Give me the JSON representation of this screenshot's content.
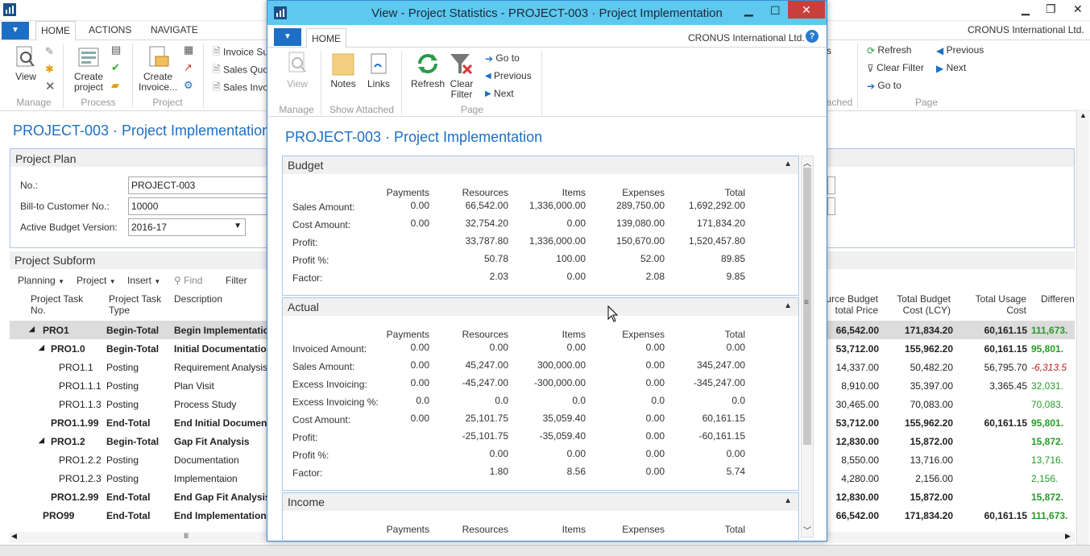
{
  "background": {
    "tabs": [
      "HOME",
      "ACTIONS",
      "NAVIGATE"
    ],
    "company": "CRONUS International Ltd.",
    "ribbon": {
      "view": "View",
      "create_project": "Create project",
      "create_invoice": "Create Invoice...",
      "invoice_items": [
        "Invoice Su",
        "Sales Quo",
        "Sales Invo"
      ],
      "right_items": [
        "Refresh",
        "Clear Filter",
        "Go to"
      ],
      "previous": "Previous",
      "next": "Next",
      "groups": [
        "Manage",
        "Process",
        "Project",
        "ached",
        "Page"
      ]
    },
    "page_title": "PROJECT-003 · Project Implementation",
    "plan_title": "Project Plan",
    "fields": [
      {
        "label": "No.:",
        "value": "PROJECT-003"
      },
      {
        "label": "Bill-to Customer No.:",
        "value": "10000"
      },
      {
        "label": "Active Budget Version:",
        "value": "2016-17"
      }
    ],
    "subform_title": "Project Subform",
    "subform_actions": [
      "Planning",
      "Project",
      "Insert",
      "Find",
      "Filter"
    ],
    "columns": {
      "task_no": "Project Task No.",
      "task_type": "Project Task Type",
      "description": "Description",
      "resource_budget": "urce Budget total Price",
      "total_budget": "Total Budget Cost (LCY)",
      "total_usage": "Total Usage Cost",
      "difference": "Differen"
    },
    "rows": [
      {
        "no": "PRO1",
        "type": "Begin-Total",
        "desc": "Begin Implementatio",
        "rb": "66,542.00",
        "tb": "171,834.20",
        "tu": "60,161.15",
        "diff": "111,673.",
        "bold": true,
        "indent": 0,
        "exp": true
      },
      {
        "no": "PRO1.0",
        "type": "Begin-Total",
        "desc": "Initial Documentatio",
        "rb": "53,712.00",
        "tb": "155,962.20",
        "tu": "60,161.15",
        "diff": "95,801.",
        "bold": true,
        "indent": 1,
        "exp": true
      },
      {
        "no": "PRO1.1",
        "type": "Posting",
        "desc": "Requirement Analysis",
        "rb": "14,337.00",
        "tb": "50,482.20",
        "tu": "56,795.70",
        "diff": "-6,313.5",
        "bold": false,
        "indent": 2,
        "neg": true
      },
      {
        "no": "PRO1.1.1",
        "type": "Posting",
        "desc": "Plan Visit",
        "rb": "8,910.00",
        "tb": "35,397.00",
        "tu": "3,365.45",
        "diff": "32,031.",
        "bold": false,
        "indent": 2
      },
      {
        "no": "PRO1.1.3",
        "type": "Posting",
        "desc": "Process Study",
        "rb": "30,465.00",
        "tb": "70,083.00",
        "tu": "",
        "diff": "70,083.",
        "bold": false,
        "indent": 2
      },
      {
        "no": "PRO1.1.99",
        "type": "End-Total",
        "desc": "End Initial Documen",
        "rb": "53,712.00",
        "tb": "155,962.20",
        "tu": "60,161.15",
        "diff": "95,801.",
        "bold": true,
        "indent": 1
      },
      {
        "no": "PRO1.2",
        "type": "Begin-Total",
        "desc": "Gap Fit Analysis",
        "rb": "12,830.00",
        "tb": "15,872.00",
        "tu": "",
        "diff": "15,872.",
        "bold": true,
        "indent": 1,
        "exp": true
      },
      {
        "no": "PRO1.2.2",
        "type": "Posting",
        "desc": "Documentation",
        "rb": "8,550.00",
        "tb": "13,716.00",
        "tu": "",
        "diff": "13,716.",
        "bold": false,
        "indent": 2
      },
      {
        "no": "PRO1.2.3",
        "type": "Posting",
        "desc": "Implementaion",
        "rb": "4,280.00",
        "tb": "2,156.00",
        "tu": "",
        "diff": "2,156.",
        "bold": false,
        "indent": 2
      },
      {
        "no": "PRO1.2.99",
        "type": "End-Total",
        "desc": "End Gap Fit Analysis",
        "rb": "12,830.00",
        "tb": "15,872.00",
        "tu": "",
        "diff": "15,872.",
        "bold": true,
        "indent": 1
      },
      {
        "no": "PRO99",
        "type": "End-Total",
        "desc": "End Implementation",
        "rb": "66,542.00",
        "tb": "171,834.20",
        "tu": "60,161.15",
        "diff": "111,673.",
        "bold": true,
        "indent": 0
      }
    ]
  },
  "modal": {
    "title": "View - Project Statistics - PROJECT-003 · Project Implementation",
    "tab": "HOME",
    "company": "CRONUS International Ltd.",
    "ribbon": {
      "view": "View",
      "notes": "Notes",
      "links": "Links",
      "refresh": "Refresh",
      "clear_filter": "Clear Filter",
      "goto": "Go to",
      "previous": "Previous",
      "next": "Next",
      "groups": [
        "Manage",
        "Show Attached",
        "Page"
      ]
    },
    "page_title": "PROJECT-003 · Project Implementation",
    "col_headers": [
      "Payments",
      "Resources",
      "Items",
      "Expenses",
      "Total"
    ],
    "budget": {
      "title": "Budget",
      "rows": [
        {
          "label": "Sales Amount:",
          "v": [
            "0.00",
            "66,542.00",
            "1,336,000.00",
            "289,750.00",
            "1,692,292.00"
          ]
        },
        {
          "label": "Cost Amount:",
          "v": [
            "0.00",
            "32,754.20",
            "0.00",
            "139,080.00",
            "171,834.20"
          ]
        },
        {
          "label": "Profit:",
          "v": [
            "",
            "33,787.80",
            "1,336,000.00",
            "150,670.00",
            "1,520,457.80"
          ]
        },
        {
          "label": "Profit %:",
          "v": [
            "",
            "50.78",
            "100.00",
            "52.00",
            "89.85"
          ]
        },
        {
          "label": "Factor:",
          "v": [
            "",
            "2.03",
            "0.00",
            "2.08",
            "9.85"
          ]
        }
      ]
    },
    "actual": {
      "title": "Actual",
      "rows": [
        {
          "label": "Invoiced Amount:",
          "v": [
            "0.00",
            "0.00",
            "0.00",
            "0.00",
            "0.00"
          ]
        },
        {
          "label": "Sales Amount:",
          "v": [
            "0.00",
            "45,247.00",
            "300,000.00",
            "0.00",
            "345,247.00"
          ]
        },
        {
          "label": "Excess Invoicing:",
          "v": [
            "0.00",
            "-45,247.00",
            "-300,000.00",
            "0.00",
            "-345,247.00"
          ]
        },
        {
          "label": "Excess Invoicing %:",
          "v": [
            "0.0",
            "0.0",
            "0.0",
            "0.0",
            "0.0"
          ]
        },
        {
          "label": "Cost Amount:",
          "v": [
            "0.00",
            "25,101.75",
            "35,059.40",
            "0.00",
            "60,161.15"
          ]
        },
        {
          "label": "Profit:",
          "v": [
            "",
            "-25,101.75",
            "-35,059.40",
            "0.00",
            "-60,161.15"
          ]
        },
        {
          "label": "Profit %:",
          "v": [
            "",
            "0.00",
            "0.00",
            "0.00",
            "0.00"
          ]
        },
        {
          "label": "Factor:",
          "v": [
            "",
            "1.80",
            "8.56",
            "0.00",
            "5.74"
          ]
        }
      ]
    },
    "income": {
      "title": "Income"
    }
  }
}
